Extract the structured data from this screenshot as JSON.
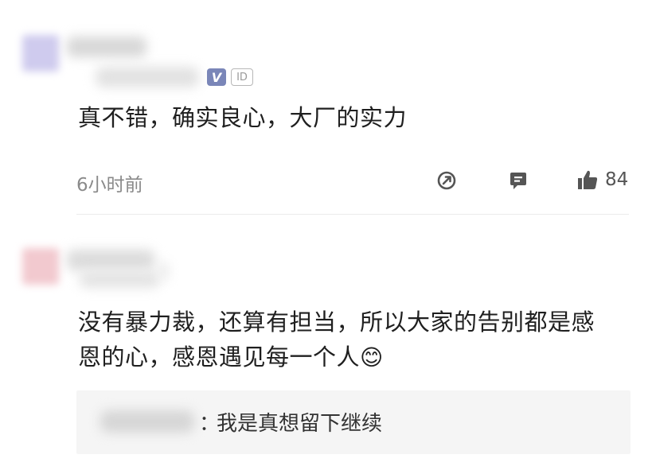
{
  "comments": [
    {
      "text": "真不错，确实良心，大厂的实力",
      "time": "6小时前",
      "badge_v": "V",
      "badge_id": "ID",
      "likes": "84",
      "avatar_color": "#cfcbee"
    },
    {
      "text_line1": "没有暴力裁，还算有担当，所以大家的告别都是感",
      "text_line2": "恩的心，感恩遇见每一个人",
      "emoji": "😊",
      "avatar_color": "#f2c9cf",
      "reply": {
        "colon": "：",
        "text": "我是真想留下继续"
      }
    }
  ],
  "icons": [
    "share-icon",
    "comment-icon",
    "thumbs-up-icon"
  ]
}
